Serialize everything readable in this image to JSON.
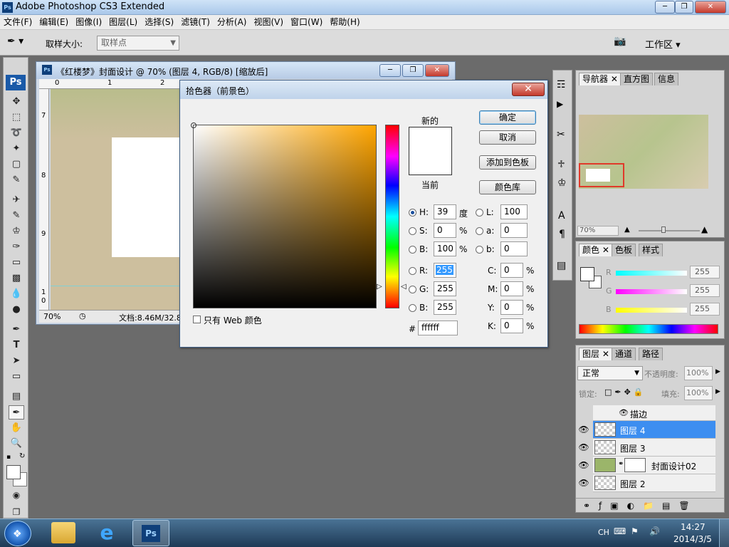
{
  "window": {
    "app_icon": "Ps",
    "title": "Adobe Photoshop CS3 Extended"
  },
  "menu": [
    "文件(F)",
    "编辑(E)",
    "图像(I)",
    "图层(L)",
    "选择(S)",
    "滤镜(T)",
    "分析(A)",
    "视图(V)",
    "窗口(W)",
    "帮助(H)"
  ],
  "options": {
    "sample_size_label": "取样大小:",
    "sample_size_value": "取样点",
    "workspace_label": "工作区"
  },
  "toolbox": {
    "logo": "Ps"
  },
  "document": {
    "title": "《红楼梦》封面设计 @ 70% (图层 4, RGB/8) [缩放后]",
    "ruler_top": [
      "0",
      "1",
      "2"
    ],
    "ruler_left": [
      "7",
      "8",
      "9",
      "1",
      "0"
    ],
    "zoom": "70%",
    "doc_info": "文档:8.46M/32.8"
  },
  "color_picker": {
    "title": "拾色器（前景色）",
    "new_label": "新的",
    "current_label": "当前",
    "new_color": "#ffffff",
    "current_color": "#ffffff",
    "ok": "确定",
    "cancel": "取消",
    "add_swatch": "添加到色板",
    "libraries": "颜色库",
    "web_only": "只有 Web 颜色",
    "H": {
      "label": "H:",
      "value": "39",
      "unit": "度"
    },
    "S": {
      "label": "S:",
      "value": "0",
      "unit": "%"
    },
    "Bv": {
      "label": "B:",
      "value": "100",
      "unit": "%"
    },
    "R": {
      "label": "R:",
      "value": "255"
    },
    "G": {
      "label": "G:",
      "value": "255"
    },
    "Bb": {
      "label": "B:",
      "value": "255"
    },
    "L": {
      "label": "L:",
      "value": "100"
    },
    "a": {
      "label": "a:",
      "value": "0"
    },
    "b": {
      "label": "b:",
      "value": "0"
    },
    "C": {
      "label": "C:",
      "value": "0",
      "unit": "%"
    },
    "M": {
      "label": "M:",
      "value": "0",
      "unit": "%"
    },
    "Y": {
      "label": "Y:",
      "value": "0",
      "unit": "%"
    },
    "K": {
      "label": "K:",
      "value": "0",
      "unit": "%"
    },
    "hex_label": "#",
    "hex": "ffffff"
  },
  "navigator": {
    "tabs": [
      "导航器",
      "直方图",
      "信息"
    ],
    "zoom": "70%"
  },
  "color_panel": {
    "tabs": [
      "颜色",
      "色板",
      "样式"
    ],
    "R": {
      "label": "R",
      "value": "255"
    },
    "G": {
      "label": "G",
      "value": "255"
    },
    "B": {
      "label": "B",
      "value": "255"
    }
  },
  "layers_panel": {
    "tabs": [
      "图层",
      "通道",
      "路径"
    ],
    "blend_mode": "正常",
    "opacity_label": "不透明度:",
    "opacity": "100%",
    "lock_label": "锁定:",
    "fill_label": "填充:",
    "fill": "100%",
    "effect_name": "描边",
    "layers": [
      {
        "name": "图层 4",
        "selected": true
      },
      {
        "name": "图层 3",
        "selected": false
      },
      {
        "name": "封面设计02",
        "selected": false
      },
      {
        "name": "图层 2",
        "selected": false
      }
    ]
  },
  "taskbar": {
    "ime": "CH",
    "time": "14:27",
    "date": "2014/3/5",
    "ps_label": "Ps"
  }
}
